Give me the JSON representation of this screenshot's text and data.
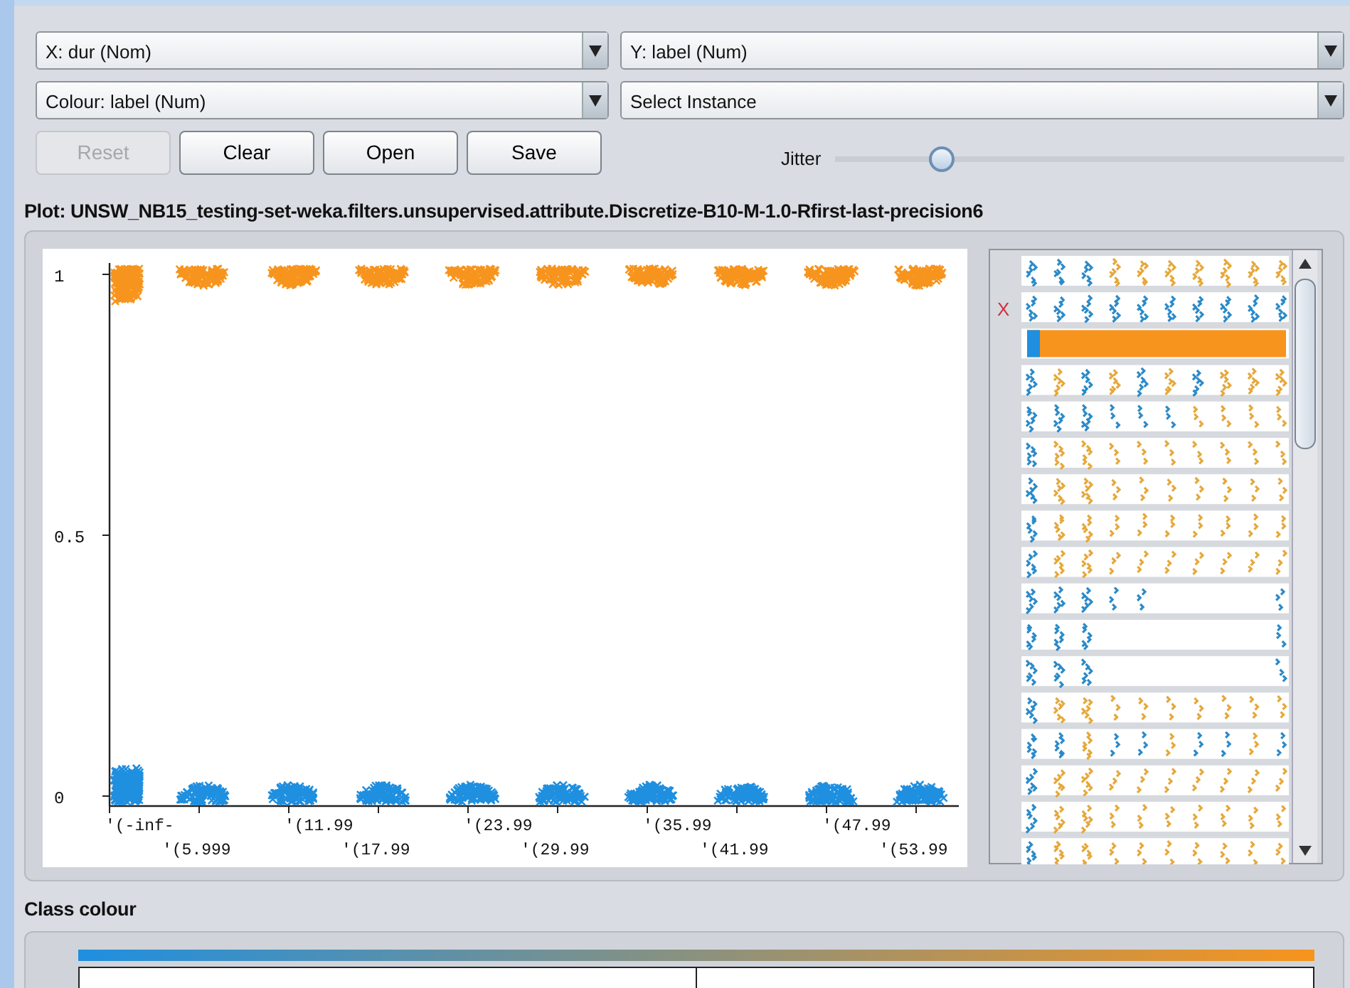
{
  "selectors": [
    {
      "kind": "x_axis",
      "value": "X: dur (Nom)"
    },
    {
      "kind": "y_axis",
      "value": "Y: label (Num)"
    },
    {
      "kind": "colour",
      "value": "Colour: label (Num)"
    },
    {
      "kind": "instance",
      "value": "Select Instance"
    }
  ],
  "buttons": [
    {
      "label": "Reset",
      "disabled": true
    },
    {
      "label": "Clear",
      "disabled": false
    },
    {
      "label": "Open",
      "disabled": false
    },
    {
      "label": "Save",
      "disabled": false
    }
  ],
  "jitter": {
    "label": "Jitter",
    "level": 0.21
  },
  "plot_title": "Plot: UNSW_NB15_testing-set-weka.filters.unsupervised.attribute.Discretize-B10-M-1.0-Rfirst-last-precision6",
  "plot": {
    "y_labels": [
      "1",
      "0.5",
      "0"
    ],
    "x_labels": [
      "'(-inf-",
      "'(5.999",
      "'(11.99",
      "'(17.99",
      "'(23.99",
      "'(29.99",
      "'(35.99",
      "'(41.99",
      "'(47.99",
      "'(53.99"
    ]
  },
  "matrix": {
    "selected_marker": "X"
  },
  "class_colour": {
    "title": "Class colour"
  }
}
